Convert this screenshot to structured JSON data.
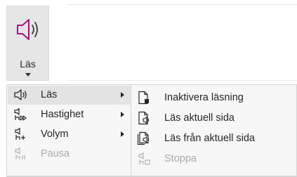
{
  "ribbon": {
    "read_button": {
      "label": "Läs",
      "icon": "speaker-icon"
    }
  },
  "read_menu": {
    "items": [
      {
        "label": "Läs",
        "icon": "speaker-icon",
        "has_submenu": true,
        "highlighted": true,
        "disabled": false
      },
      {
        "label": "Hastighet",
        "icon": "speed-icon",
        "has_submenu": true,
        "highlighted": false,
        "disabled": false
      },
      {
        "label": "Volym",
        "icon": "volume-icon",
        "has_submenu": true,
        "highlighted": false,
        "disabled": false
      },
      {
        "label": "Pausa",
        "icon": "pause-icon",
        "has_submenu": false,
        "highlighted": false,
        "disabled": true
      }
    ]
  },
  "read_submenu": {
    "items": [
      {
        "label": "Inaktivera läsning",
        "icon": "disable-reading-icon",
        "disabled": false
      },
      {
        "label": "Läs aktuell sida",
        "icon": "read-page-icon",
        "disabled": false
      },
      {
        "label": "Läs från aktuell sida",
        "icon": "read-from-page-icon",
        "disabled": false
      },
      {
        "label": "Stoppa",
        "icon": "stop-icon",
        "disabled": true
      }
    ]
  },
  "colors": {
    "accent": "#a5147a",
    "text": "#262626",
    "disabled": "#a8a8a8",
    "menu_bg": "#f7f7f7",
    "highlight": "#e3e3e3"
  }
}
